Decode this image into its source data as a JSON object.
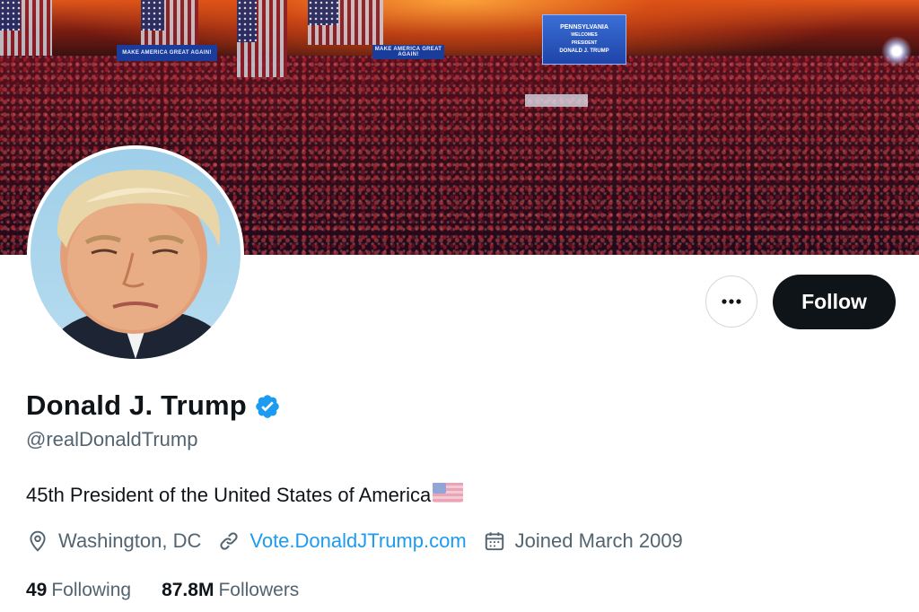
{
  "banner": {
    "rally_sign_left": "MAKE AMERICA GREAT AGAIN!",
    "rally_sign_mid": "MAKE AMERICA GREAT AGAIN!",
    "screen_line1": "PENNSYLVANIA",
    "screen_line2": "WELCOMES",
    "screen_line3": "PRESIDENT",
    "screen_line4": "DONALD J. TRUMP"
  },
  "profile": {
    "name": "Donald J. Trump",
    "handle": "@realDonaldTrump",
    "bio": "45th President of the United States of America",
    "bio_emoji_icon": "us-flag-emoji",
    "location": "Washington, DC",
    "website": "Vote.DonaldJTrump.com",
    "joined": "Joined March 2009"
  },
  "stats": {
    "following_count": "49",
    "following_label": "Following",
    "followers_count": "87.8M",
    "followers_label": "Followers"
  },
  "actions": {
    "follow_label": "Follow",
    "more_icon": "more-horizontal-icon"
  },
  "colors": {
    "primary_text": "#0f1419",
    "secondary_text": "#536471",
    "link": "#1d9bf0",
    "verified_badge": "#1d9bf0",
    "follow_button_bg": "#0f1419"
  }
}
